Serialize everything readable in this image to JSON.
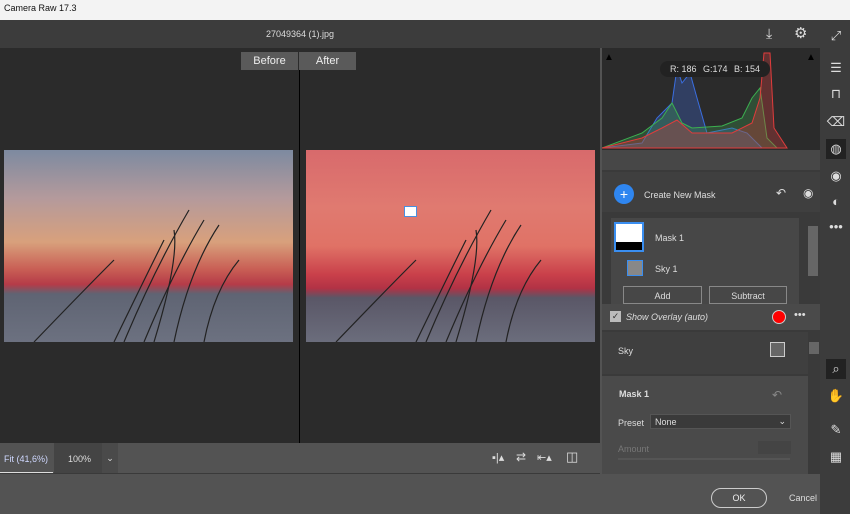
{
  "app": {
    "title": "Camera Raw 17.3",
    "filename": "27049364 (1).jpg"
  },
  "view": {
    "before_label": "Before",
    "after_label": "After"
  },
  "zoom": {
    "fit_label": "Fit (41,6%)",
    "zoom_100": "100%"
  },
  "histogram": {
    "r": "R: 186",
    "g": "G:174",
    "b": "B: 154"
  },
  "masks": {
    "create_label": "Create New Mask",
    "items": [
      {
        "label": "Mask 1"
      },
      {
        "label": "Sky 1"
      }
    ],
    "add_label": "Add",
    "subtract_label": "Subtract",
    "overlay_label": "Show Overlay (auto)",
    "overlay_checked": true,
    "overlay_color": "#ff0000"
  },
  "sky": {
    "label": "Sky"
  },
  "mask_props": {
    "title": "Mask 1",
    "preset_label": "Preset",
    "preset_value": "None",
    "amount_label": "Amount"
  },
  "footer": {
    "ok_label": "OK",
    "cancel_label": "Cancel"
  }
}
